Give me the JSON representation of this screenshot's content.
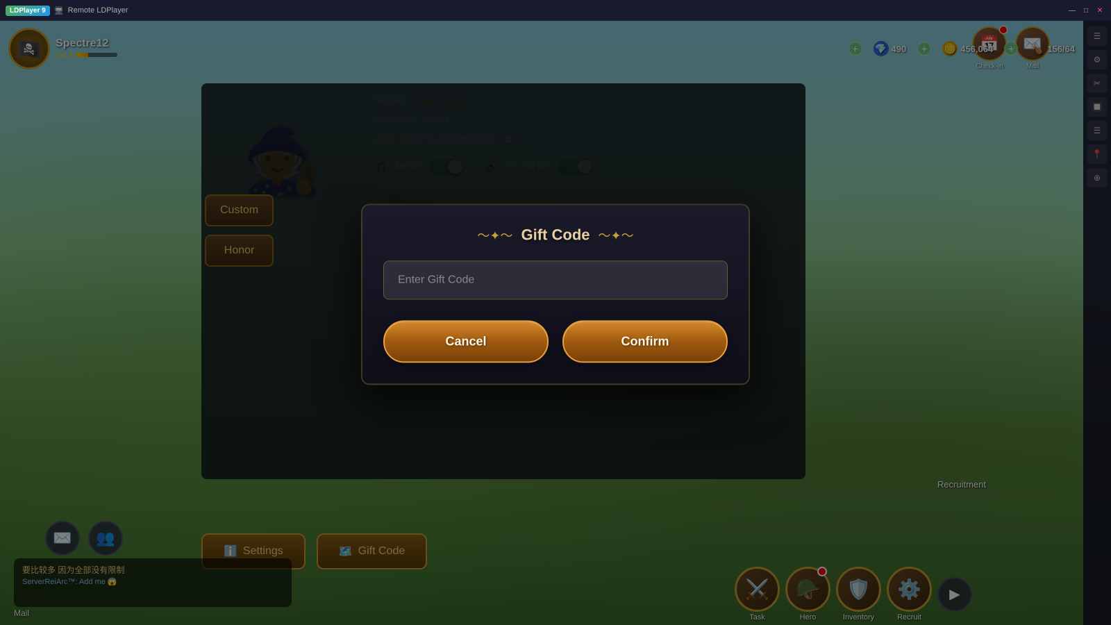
{
  "app": {
    "title": "LDPlayer 9",
    "remote_label": "Remote LDPlayer"
  },
  "player": {
    "name": "Spectre12",
    "level": "Lvl 4",
    "level_pct": 30
  },
  "resources": {
    "gems": "490",
    "gold": "456,064",
    "food": "156/64"
  },
  "top_icons": {
    "checkin": "Check-in",
    "mail": "Mail"
  },
  "settings_panel": {
    "server_label": "Server:",
    "server_name": "1 War Inferno",
    "server_id_label": "Server ID:",
    "server_id": "26250",
    "uid_label": "UID:",
    "uid_value": "109075123923638029",
    "music_label": "Music",
    "sound_label": "Sound FX"
  },
  "side_buttons": {
    "custom": "Custom",
    "honor": "Honor"
  },
  "bottom_buttons": {
    "settings": "Settings",
    "gift_code": "Gift Code"
  },
  "modal": {
    "title": "Gift Code",
    "input_placeholder": "Enter Gift Code",
    "cancel_label": "Cancel",
    "confirm_label": "Confirm"
  },
  "bottom_bar": {
    "chat_text": "要比较多 因为全部没有限制",
    "chat_server": "ServerReiArc™: Add me 😱",
    "mail_label": "Mail",
    "task_label": "Task",
    "hero_label": "Hero",
    "inventory_label": "Inventory",
    "recruit_label": "Recruit"
  },
  "recruitment_label": "Recruitment"
}
